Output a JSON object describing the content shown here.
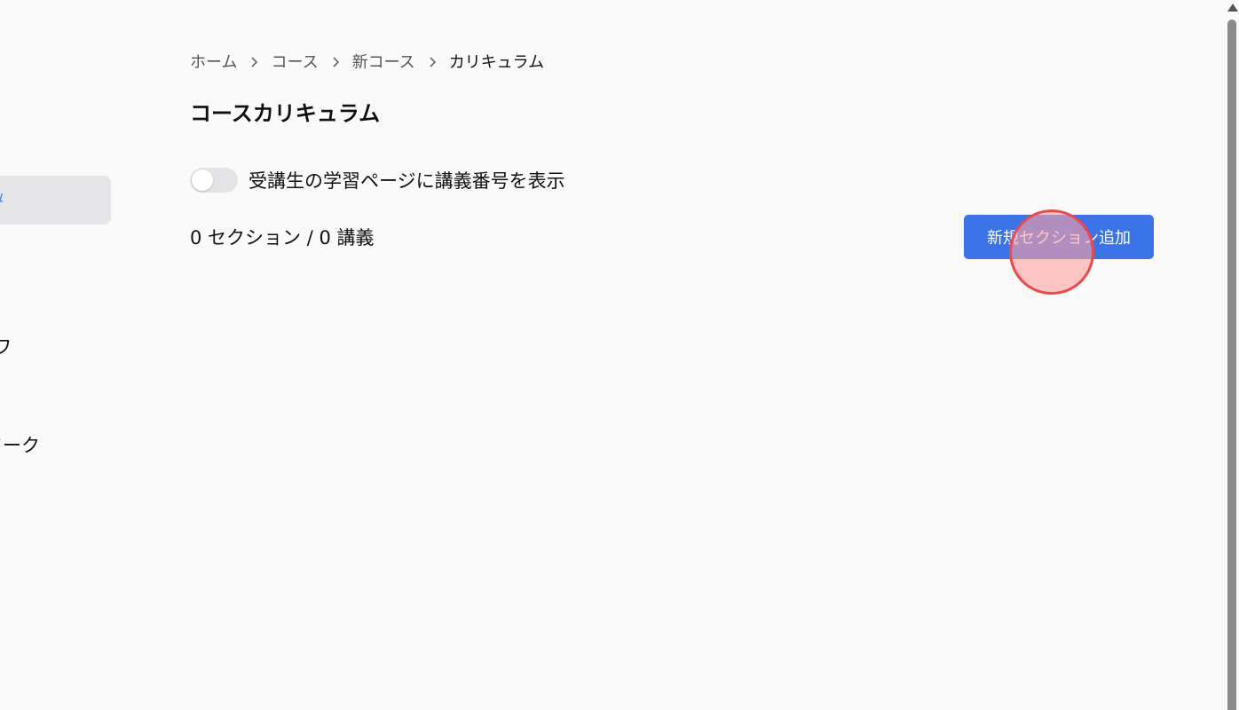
{
  "sidebar": {
    "active_item_label": "ム",
    "item_1_label": "ワ",
    "item_2_label": "ワーク"
  },
  "breadcrumb": {
    "items": [
      "ホーム",
      "コース",
      "新コース",
      "カリキュラム"
    ]
  },
  "page_title": "コースカリキュラム",
  "lecture_number_toggle": {
    "label": "受講生の学習ページに講義番号を表示",
    "enabled": false
  },
  "summary": {
    "counts_text": "0 セクション / 0 講義"
  },
  "actions": {
    "add_section_label": "新規セクション追加"
  },
  "colors": {
    "accent": "#3b73e8",
    "background": "#fafafa",
    "sidebar_active_bg": "#e6e6e8",
    "click_indicator": "#f04848"
  }
}
